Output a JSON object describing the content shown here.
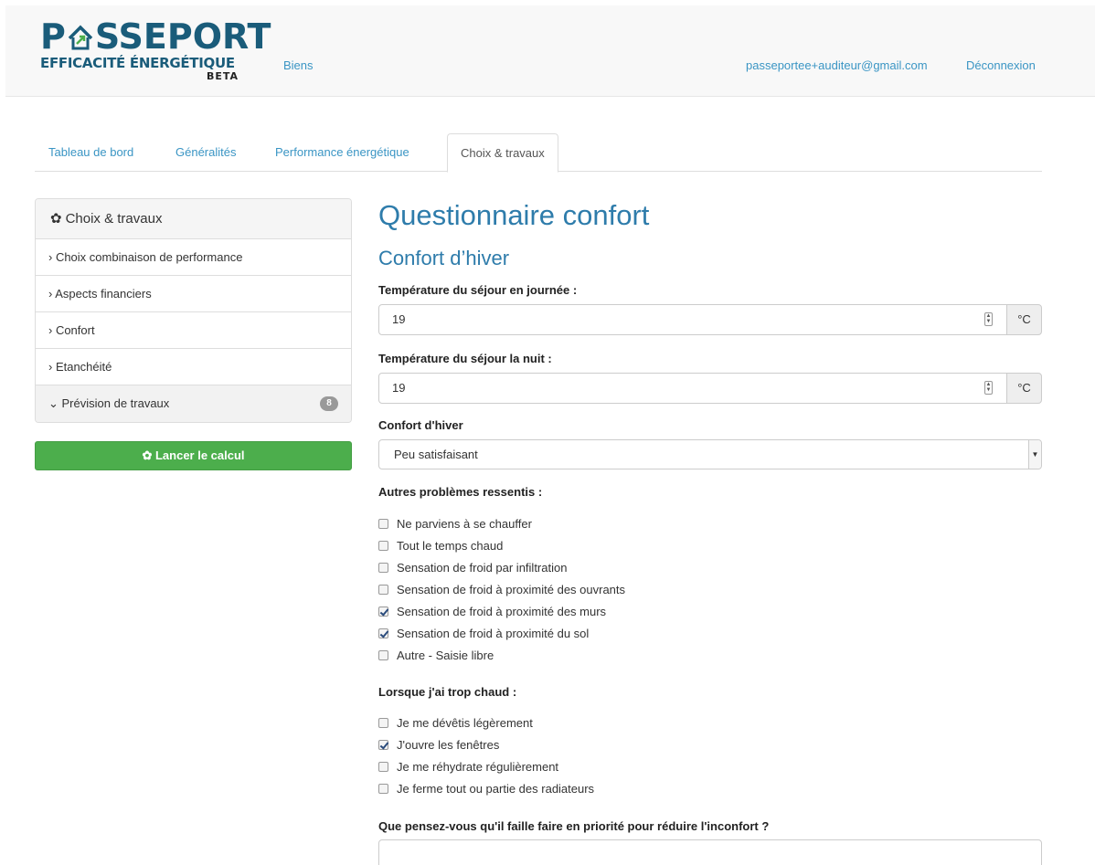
{
  "header": {
    "logo_line1_pre": "P",
    "logo_line1_post": "SSEPORT",
    "logo_line2": "EFFICACITÉ ÉNERGÉTIQUE",
    "logo_line3": "BETA",
    "nav_biens": "Biens",
    "user_email": "passeportee+auditeur@gmail.com",
    "logout": "Déconnexion"
  },
  "tabs": [
    {
      "label": "Tableau de bord"
    },
    {
      "label": "Généralités"
    },
    {
      "label": "Performance énergétique"
    },
    {
      "label": "Choix & travaux",
      "active": true
    }
  ],
  "sidebar": {
    "title": "Choix & travaux",
    "items": [
      {
        "label": "› Choix combinaison de performance"
      },
      {
        "label": "› Aspects financiers"
      },
      {
        "label": "› Confort"
      },
      {
        "label": "› Etanchéité"
      },
      {
        "label": "⌄ Prévision de travaux",
        "badge": "8"
      }
    ],
    "calc_button": "✿ Lancer le calcul"
  },
  "main": {
    "title": "Questionnaire confort",
    "subtitle": "Confort d’hiver",
    "temp_day_label": "Température du séjour en journée :",
    "temp_day_value": "19",
    "temp_night_label": "Température du séjour la nuit :",
    "temp_night_value": "19",
    "unit": "°C",
    "winter_comfort_label": "Confort d'hiver",
    "winter_comfort_value": "Peu satisfaisant",
    "problems_label": "Autres problèmes ressentis :",
    "problems": [
      {
        "label": "Ne parviens à se chauffer",
        "checked": false
      },
      {
        "label": "Tout le temps chaud",
        "checked": false
      },
      {
        "label": "Sensation de froid par infiltration",
        "checked": false
      },
      {
        "label": "Sensation de froid à proximité des ouvrants",
        "checked": false
      },
      {
        "label": "Sensation de froid à proximité des murs",
        "checked": true
      },
      {
        "label": "Sensation de froid à proximité du sol",
        "checked": true
      },
      {
        "label": "Autre - Saisie libre",
        "checked": false
      }
    ],
    "too_hot_label": "Lorsque j'ai trop chaud :",
    "too_hot": [
      {
        "label": "Je me dévêtis légèrement",
        "checked": false
      },
      {
        "label": "J'ouvre les fenêtres",
        "checked": true
      },
      {
        "label": "Je me réhydrate régulièrement",
        "checked": false
      },
      {
        "label": "Je ferme tout ou partie des radiateurs",
        "checked": false
      }
    ],
    "priority_question": "Que pensez-vous qu'il faille faire en priorité pour réduire l'inconfort ?"
  },
  "colors": {
    "brand": "#1a5c7a",
    "link": "#3a95c4",
    "heading": "#2e7cab",
    "success": "#4cae4c"
  }
}
